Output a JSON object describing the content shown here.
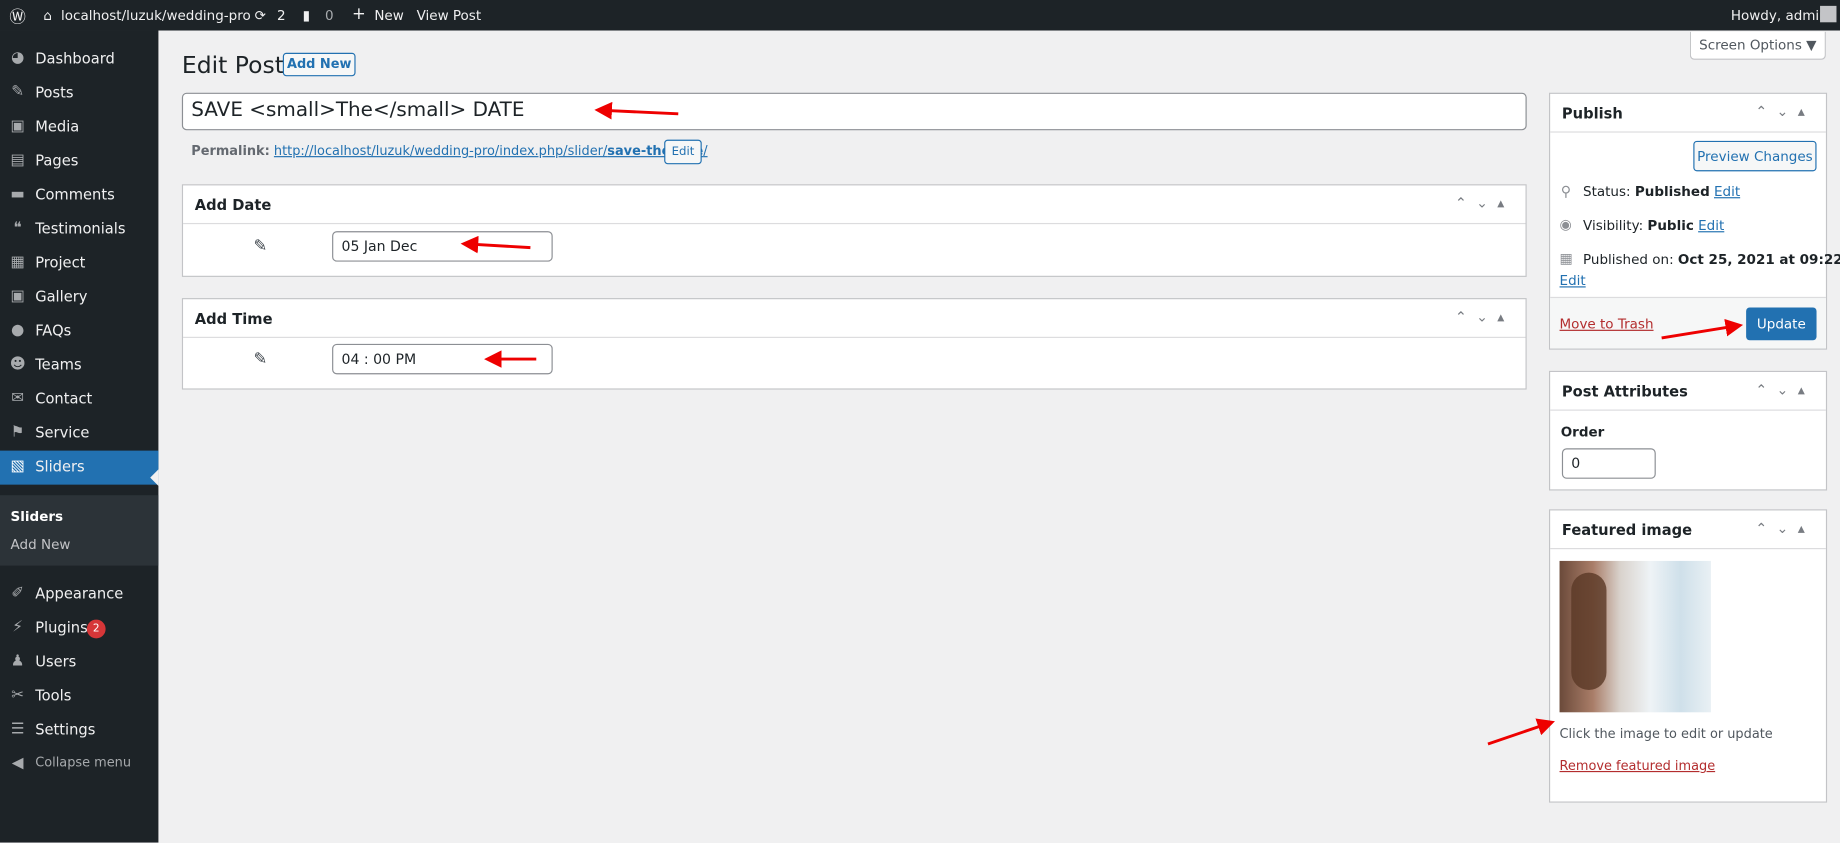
{
  "adminbar": {
    "site": "localhost/luzuk/wedding-pro",
    "updates": "2",
    "comments": "0",
    "new": "New",
    "view": "View Post",
    "howdy": "Howdy, admin"
  },
  "sidebar": {
    "items": [
      {
        "label": "Dashboard",
        "icon": "dashboard-icon",
        "glyph": "◕"
      },
      {
        "label": "Posts",
        "icon": "pin-icon",
        "glyph": "✎"
      },
      {
        "label": "Media",
        "icon": "media-icon",
        "glyph": "▣"
      },
      {
        "label": "Pages",
        "icon": "pages-icon",
        "glyph": "▤"
      },
      {
        "label": "Comments",
        "icon": "comment-icon",
        "glyph": "▬"
      },
      {
        "label": "Testimonials",
        "icon": "testimonials-icon",
        "glyph": "❝"
      },
      {
        "label": "Project",
        "icon": "project-icon",
        "glyph": "▦"
      },
      {
        "label": "Gallery",
        "icon": "gallery-icon",
        "glyph": "▣"
      },
      {
        "label": "FAQs",
        "icon": "faq-icon",
        "glyph": "●"
      },
      {
        "label": "Teams",
        "icon": "teams-icon",
        "glyph": "☻"
      },
      {
        "label": "Contact",
        "icon": "mail-icon",
        "glyph": "✉"
      },
      {
        "label": "Service",
        "icon": "service-icon",
        "glyph": "⚑"
      },
      {
        "label": "Sliders",
        "icon": "sliders-icon",
        "glyph": "▧"
      }
    ],
    "submenu": [
      "Sliders",
      "Add New"
    ],
    "items2": [
      {
        "label": "Appearance",
        "icon": "appearance-icon",
        "glyph": "✐"
      },
      {
        "label": "Plugins",
        "icon": "plugin-icon",
        "glyph": "⚡",
        "badge": "2"
      },
      {
        "label": "Users",
        "icon": "user-icon",
        "glyph": "♟"
      },
      {
        "label": "Tools",
        "icon": "wrench-icon",
        "glyph": "✂"
      },
      {
        "label": "Settings",
        "icon": "settings-icon",
        "glyph": "☰"
      },
      {
        "label": "Collapse menu",
        "icon": "collapse-icon",
        "glyph": "◀"
      }
    ],
    "active_color": "#2271b1"
  },
  "header": {
    "title": "Edit Post",
    "add_new": "Add New",
    "screen_options": "Screen Options ▼"
  },
  "post": {
    "title": "SAVE <small>The</small> DATE",
    "permalink_label": "Permalink:",
    "permalink_base": "http://localhost/luzuk/wedding-pro/index.php/slider/",
    "permalink_slug": "save-thedate",
    "permalink_end": "/",
    "edit": "Edit"
  },
  "metaboxes": {
    "date": {
      "title": "Add Date",
      "value": "05 Jan Dec"
    },
    "time": {
      "title": "Add Time",
      "value": "04 : 00 PM"
    }
  },
  "publish": {
    "title": "Publish",
    "preview": "Preview Changes",
    "status_label": "Status:",
    "status": "Published",
    "visibility_label": "Visibility:",
    "visibility": "Public",
    "published_label": "Published on:",
    "published": "Oct 25, 2021 at 09:22",
    "edit": "Edit",
    "trash": "Move to Trash",
    "update": "Update"
  },
  "attributes": {
    "title": "Post Attributes",
    "order_label": "Order",
    "order": "0"
  },
  "featured": {
    "title": "Featured image",
    "hint": "Click the image to edit or update",
    "remove": "Remove featured image"
  }
}
